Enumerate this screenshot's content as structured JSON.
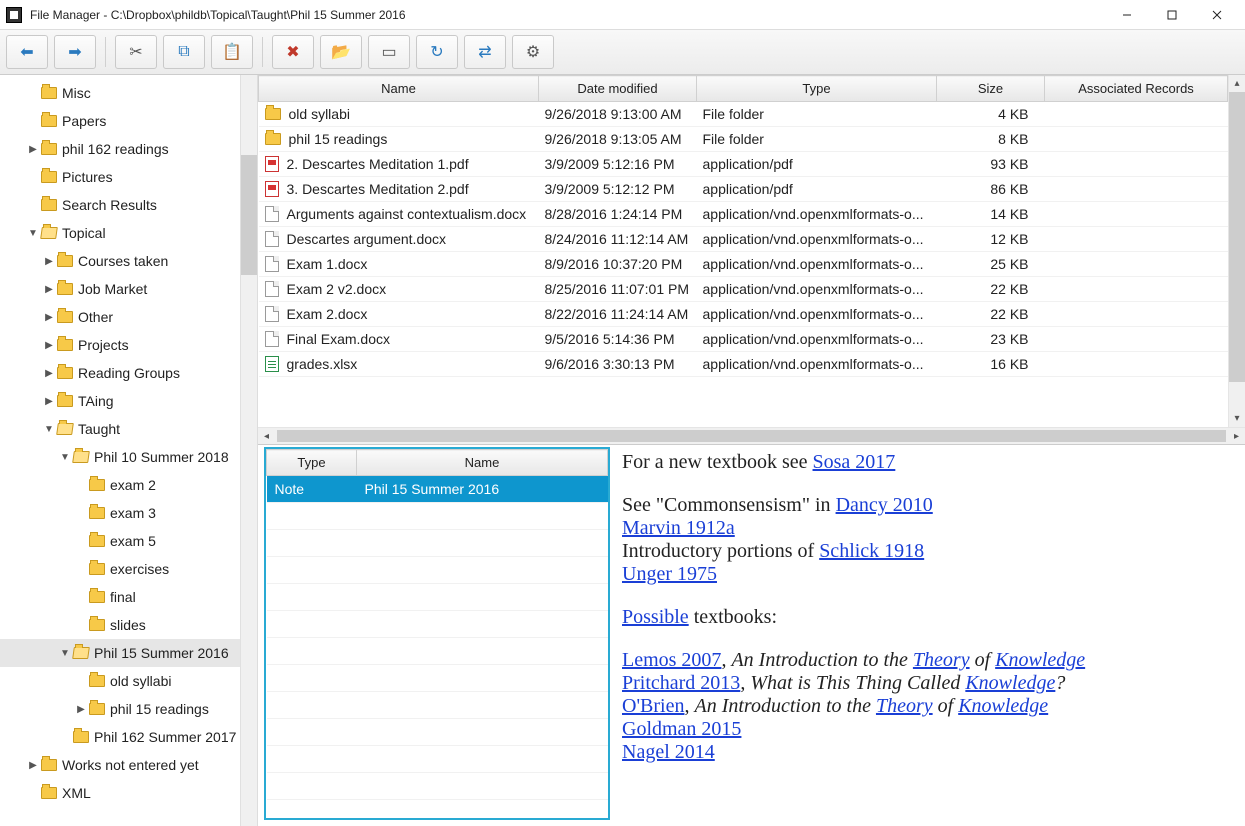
{
  "window": {
    "title": "File Manager - C:\\Dropbox\\phildb\\Topical\\Taught\\Phil 15 Summer 2016"
  },
  "toolbar": {
    "back": "←",
    "forward": "→",
    "cut": "✂",
    "copy": "⧉",
    "paste": "📋",
    "delete": "✖",
    "newfolder": "📂",
    "rename": "▭",
    "refresh": "↻",
    "mapping": "⇄",
    "gear": "⚙"
  },
  "tree": [
    {
      "depth": 1,
      "tw": "",
      "icon": "folder",
      "label": "Misc"
    },
    {
      "depth": 1,
      "tw": "",
      "icon": "folder",
      "label": "Papers"
    },
    {
      "depth": 1,
      "tw": "▶",
      "icon": "folder",
      "label": "phil 162 readings"
    },
    {
      "depth": 1,
      "tw": "",
      "icon": "folder",
      "label": "Pictures"
    },
    {
      "depth": 1,
      "tw": "",
      "icon": "folder",
      "label": "Search Results"
    },
    {
      "depth": 1,
      "tw": "▼",
      "icon": "folder-open",
      "label": "Topical"
    },
    {
      "depth": 2,
      "tw": "▶",
      "icon": "folder",
      "label": "Courses taken"
    },
    {
      "depth": 2,
      "tw": "▶",
      "icon": "folder",
      "label": "Job Market"
    },
    {
      "depth": 2,
      "tw": "▶",
      "icon": "folder",
      "label": "Other"
    },
    {
      "depth": 2,
      "tw": "▶",
      "icon": "folder",
      "label": "Projects"
    },
    {
      "depth": 2,
      "tw": "▶",
      "icon": "folder",
      "label": "Reading Groups"
    },
    {
      "depth": 2,
      "tw": "▶",
      "icon": "folder",
      "label": "TAing"
    },
    {
      "depth": 2,
      "tw": "▼",
      "icon": "folder-open",
      "label": "Taught"
    },
    {
      "depth": 3,
      "tw": "▼",
      "icon": "folder-open",
      "label": "Phil 10 Summer 2018"
    },
    {
      "depth": 4,
      "tw": "",
      "icon": "folder",
      "label": "exam 2"
    },
    {
      "depth": 4,
      "tw": "",
      "icon": "folder",
      "label": "exam 3"
    },
    {
      "depth": 4,
      "tw": "",
      "icon": "folder",
      "label": "exam 5"
    },
    {
      "depth": 4,
      "tw": "",
      "icon": "folder",
      "label": "exercises"
    },
    {
      "depth": 4,
      "tw": "",
      "icon": "folder",
      "label": "final"
    },
    {
      "depth": 4,
      "tw": "",
      "icon": "folder",
      "label": "slides"
    },
    {
      "depth": 3,
      "tw": "▼",
      "icon": "folder-open",
      "label": "Phil 15 Summer 2016",
      "selected": true
    },
    {
      "depth": 4,
      "tw": "",
      "icon": "folder",
      "label": "old syllabi"
    },
    {
      "depth": 4,
      "tw": "▶",
      "icon": "folder",
      "label": "phil 15 readings"
    },
    {
      "depth": 3,
      "tw": "",
      "icon": "folder",
      "label": "Phil 162 Summer 2017"
    },
    {
      "depth": 1,
      "tw": "▶",
      "icon": "folder",
      "label": "Works not entered yet"
    },
    {
      "depth": 1,
      "tw": "",
      "icon": "folder",
      "label": "XML"
    }
  ],
  "columns": {
    "name": "Name",
    "date": "Date modified",
    "type": "Type",
    "size": "Size",
    "assoc": "Associated Records"
  },
  "files": [
    {
      "icon": "folder",
      "name": "old syllabi",
      "date": "9/26/2018 9:13:00 AM",
      "type": "File folder",
      "size": "4 KB"
    },
    {
      "icon": "folder",
      "name": "phil 15 readings",
      "date": "9/26/2018 9:13:05 AM",
      "type": "File folder",
      "size": "8 KB"
    },
    {
      "icon": "pdf",
      "name": "2. Descartes Meditation 1.pdf",
      "date": "3/9/2009 5:12:16 PM",
      "type": "application/pdf",
      "size": "93 KB"
    },
    {
      "icon": "pdf",
      "name": "3. Descartes Meditation 2.pdf",
      "date": "3/9/2009 5:12:12 PM",
      "type": "application/pdf",
      "size": "86 KB"
    },
    {
      "icon": "doc",
      "name": "Arguments against contextualism.docx",
      "date": "8/28/2016 1:24:14 PM",
      "type": "application/vnd.openxmlformats-o...",
      "size": "14 KB"
    },
    {
      "icon": "doc",
      "name": "Descartes argument.docx",
      "date": "8/24/2016 11:12:14 AM",
      "type": "application/vnd.openxmlformats-o...",
      "size": "12 KB"
    },
    {
      "icon": "doc",
      "name": "Exam 1.docx",
      "date": "8/9/2016 10:37:20 PM",
      "type": "application/vnd.openxmlformats-o...",
      "size": "25 KB"
    },
    {
      "icon": "doc",
      "name": "Exam 2 v2.docx",
      "date": "8/25/2016 11:07:01 PM",
      "type": "application/vnd.openxmlformats-o...",
      "size": "22 KB"
    },
    {
      "icon": "doc",
      "name": "Exam 2.docx",
      "date": "8/22/2016 11:24:14 AM",
      "type": "application/vnd.openxmlformats-o...",
      "size": "22 KB"
    },
    {
      "icon": "doc",
      "name": "Final Exam.docx",
      "date": "9/5/2016 5:14:36 PM",
      "type": "application/vnd.openxmlformats-o...",
      "size": "23 KB"
    },
    {
      "icon": "xls",
      "name": "grades.xlsx",
      "date": "9/6/2016 3:30:13 PM",
      "type": "application/vnd.openxmlformats-o...",
      "size": "16 KB"
    }
  ],
  "records": {
    "cols": {
      "type": "Type",
      "name": "Name"
    },
    "rows": [
      {
        "type": "Note",
        "name": "Phil 15 Summer 2016",
        "selected": true
      }
    ],
    "blank_rows": 11
  },
  "note": {
    "l1a": "For a new textbook see ",
    "l1b": "Sosa 2017",
    "l2a": "See \"Commonsensism\" in ",
    "l2b": "Dancy 2010",
    "l3": "Marvin 1912a",
    "l4a": "Introductory portions of ",
    "l4b": "Schlick 1918",
    "l5": "Unger 1975",
    "l6a": "Possible",
    "l6b": " textbooks:",
    "l7a": "Lemos 2007",
    "l7b": ", ",
    "l7c": "An Introduction to the ",
    "l7d": "Theory",
    "l7e": " of ",
    "l7f": "Knowledge",
    "l8a": "Pritchard 2013",
    "l8b": ", ",
    "l8c": "What is This Thing Called ",
    "l8d": "Knowledge",
    "l8e": "?",
    "l9a": "O'Brien",
    "l9b": ", ",
    "l9c": "An Introduction to the ",
    "l9d": "Theory",
    "l9e": " of ",
    "l9f": "Knowledge",
    "l10": "Goldman 2015",
    "l11": "Nagel 2014"
  }
}
